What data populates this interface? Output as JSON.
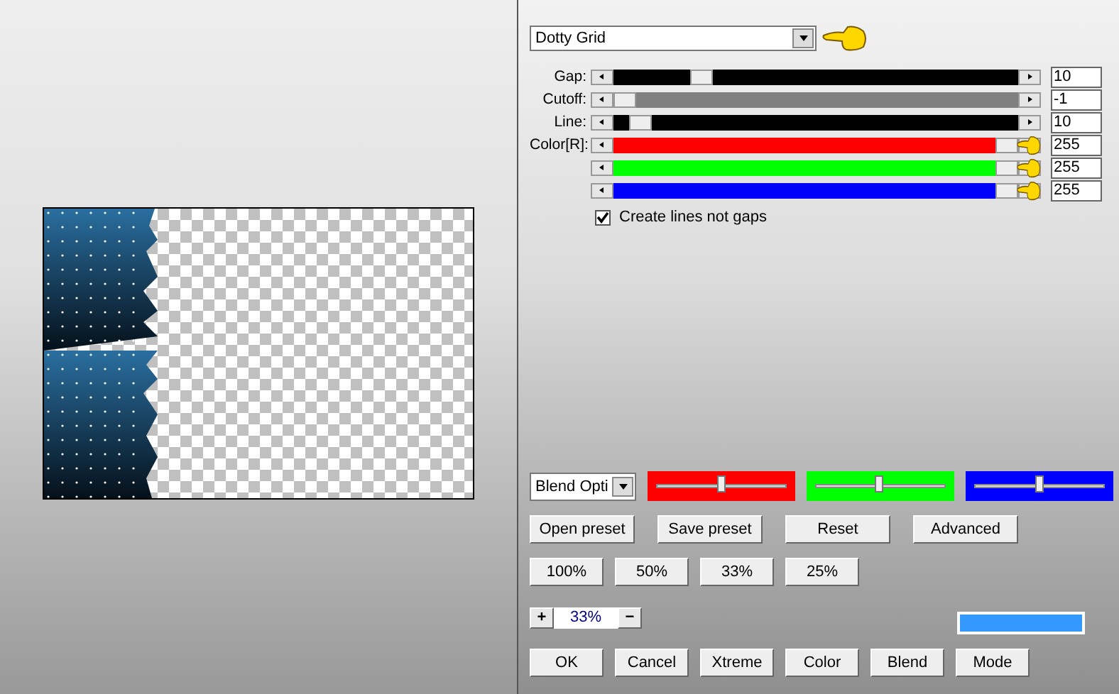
{
  "preset_dropdown": {
    "value": "Dotty Grid",
    "pointer": true
  },
  "sliders": [
    {
      "label": "Gap:",
      "level": 0.2,
      "value": "10",
      "color": "#000000",
      "pointer": false
    },
    {
      "label": "Cutoff:",
      "level": 0,
      "value": "-1",
      "color": "#808080",
      "pointer": false
    },
    {
      "label": "Line:",
      "level": 0.04,
      "value": "10",
      "color": "#000000",
      "pointer": false
    },
    {
      "label": "Color[R]:",
      "level": 1,
      "value": "255",
      "color": "#ff0000",
      "pointer": true
    },
    {
      "level": 1,
      "value": "255",
      "color": "#00ff00",
      "pointer": true
    },
    {
      "level": 1,
      "value": "255",
      "color": "#0000ff",
      "pointer": true
    }
  ],
  "checkbox": {
    "label": "Create lines not gaps",
    "checked": true
  },
  "blend_dropdown": {
    "value": "Blend Opti"
  },
  "color_sliders": [
    {
      "color": "#ff0000",
      "level": 0.5
    },
    {
      "color": "#00ff00",
      "level": 0.49
    },
    {
      "color": "#0000ff",
      "level": 0.5
    }
  ],
  "preset_buttons": [
    "Open preset",
    "Save preset",
    "Reset",
    "Advanced"
  ],
  "zoom_buttons": [
    "100%",
    "50%",
    "33%",
    "25%"
  ],
  "zoom_control": {
    "plus": "+",
    "value": "33%",
    "minus": "−"
  },
  "dialog_buttons": [
    "OK",
    "Cancel",
    "Xtreme",
    "Color",
    "Blend",
    "Mode"
  ]
}
